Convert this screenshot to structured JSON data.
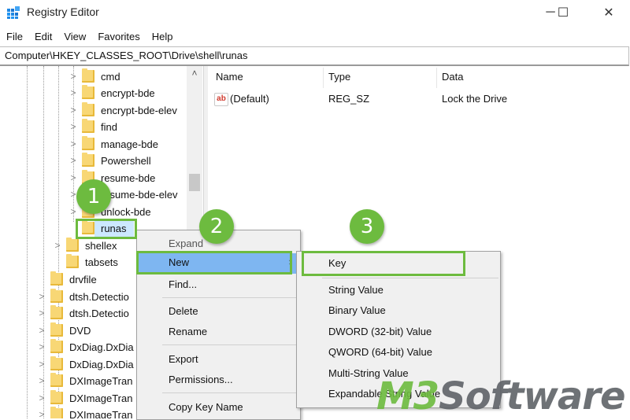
{
  "window": {
    "title": "Registry Editor",
    "icon": "registry-editor-icon",
    "controls": {
      "minimize": "─",
      "maximize": "☐",
      "close": "✕"
    }
  },
  "menubar": {
    "items": [
      "File",
      "Edit",
      "View",
      "Favorites",
      "Help"
    ]
  },
  "address": {
    "path": "Computer\\HKEY_CLASSES_ROOT\\Drive\\shell\\runas"
  },
  "tree": {
    "items": [
      {
        "label": "cmd",
        "expandable": true
      },
      {
        "label": "encrypt-bde",
        "expandable": true
      },
      {
        "label": "encrypt-bde-elev",
        "expandable": true
      },
      {
        "label": "find",
        "expandable": true
      },
      {
        "label": "manage-bde",
        "expandable": true
      },
      {
        "label": "Powershell",
        "expandable": true
      },
      {
        "label": "resume-bde",
        "expandable": true
      },
      {
        "label": "resume-bde-elev",
        "expandable": true
      },
      {
        "label": "unlock-bde",
        "expandable": true
      },
      {
        "label": "runas",
        "expandable": false,
        "selected": true
      },
      {
        "label": "shellex",
        "expandable": true
      },
      {
        "label": "tabsets",
        "expandable": false
      },
      {
        "label": "drvfile",
        "expandable": false
      },
      {
        "label": "dtsh.Detectio",
        "expandable": true
      },
      {
        "label": "dtsh.Detectio",
        "expandable": true
      },
      {
        "label": "DVD",
        "expandable": true
      },
      {
        "label": "DxDiag.DxDia",
        "expandable": true
      },
      {
        "label": "DxDiag.DxDia",
        "expandable": true
      },
      {
        "label": "DXImageTran",
        "expandable": true
      },
      {
        "label": "DXImageTran",
        "expandable": true
      },
      {
        "label": "DXImageTran",
        "expandable": true
      }
    ]
  },
  "values_pane": {
    "columns": [
      "Name",
      "Type",
      "Data"
    ],
    "rows": [
      {
        "icon": "string-value-icon",
        "icon_text": "ab",
        "name": "(Default)",
        "type": "REG_SZ",
        "data": "Lock the Drive"
      }
    ]
  },
  "context_menu": {
    "items": [
      {
        "label": "Expand"
      },
      {
        "label": "New",
        "submenu": true,
        "highlighted": true,
        "arrow": "›"
      },
      {
        "label": "Find..."
      },
      {
        "label": "Delete"
      },
      {
        "label": "Rename"
      },
      {
        "label": "Export"
      },
      {
        "label": "Permissions..."
      },
      {
        "label": "Copy Key Name"
      }
    ]
  },
  "submenu": {
    "items": [
      {
        "label": "Key",
        "highlighted": true
      },
      {
        "label": "String Value"
      },
      {
        "label": "Binary Value"
      },
      {
        "label": "DWORD (32-bit) Value"
      },
      {
        "label": "QWORD (64-bit) Value"
      },
      {
        "label": "Multi-String Value"
      },
      {
        "label": "Expandable String Value"
      }
    ]
  },
  "annotations": {
    "step1": "1",
    "step2": "2",
    "step3": "3",
    "accent": "#6dbb3f"
  },
  "watermark": {
    "part1": "M3",
    "part2": "Software"
  },
  "scrollbar": {
    "up_arrow": "˄"
  }
}
